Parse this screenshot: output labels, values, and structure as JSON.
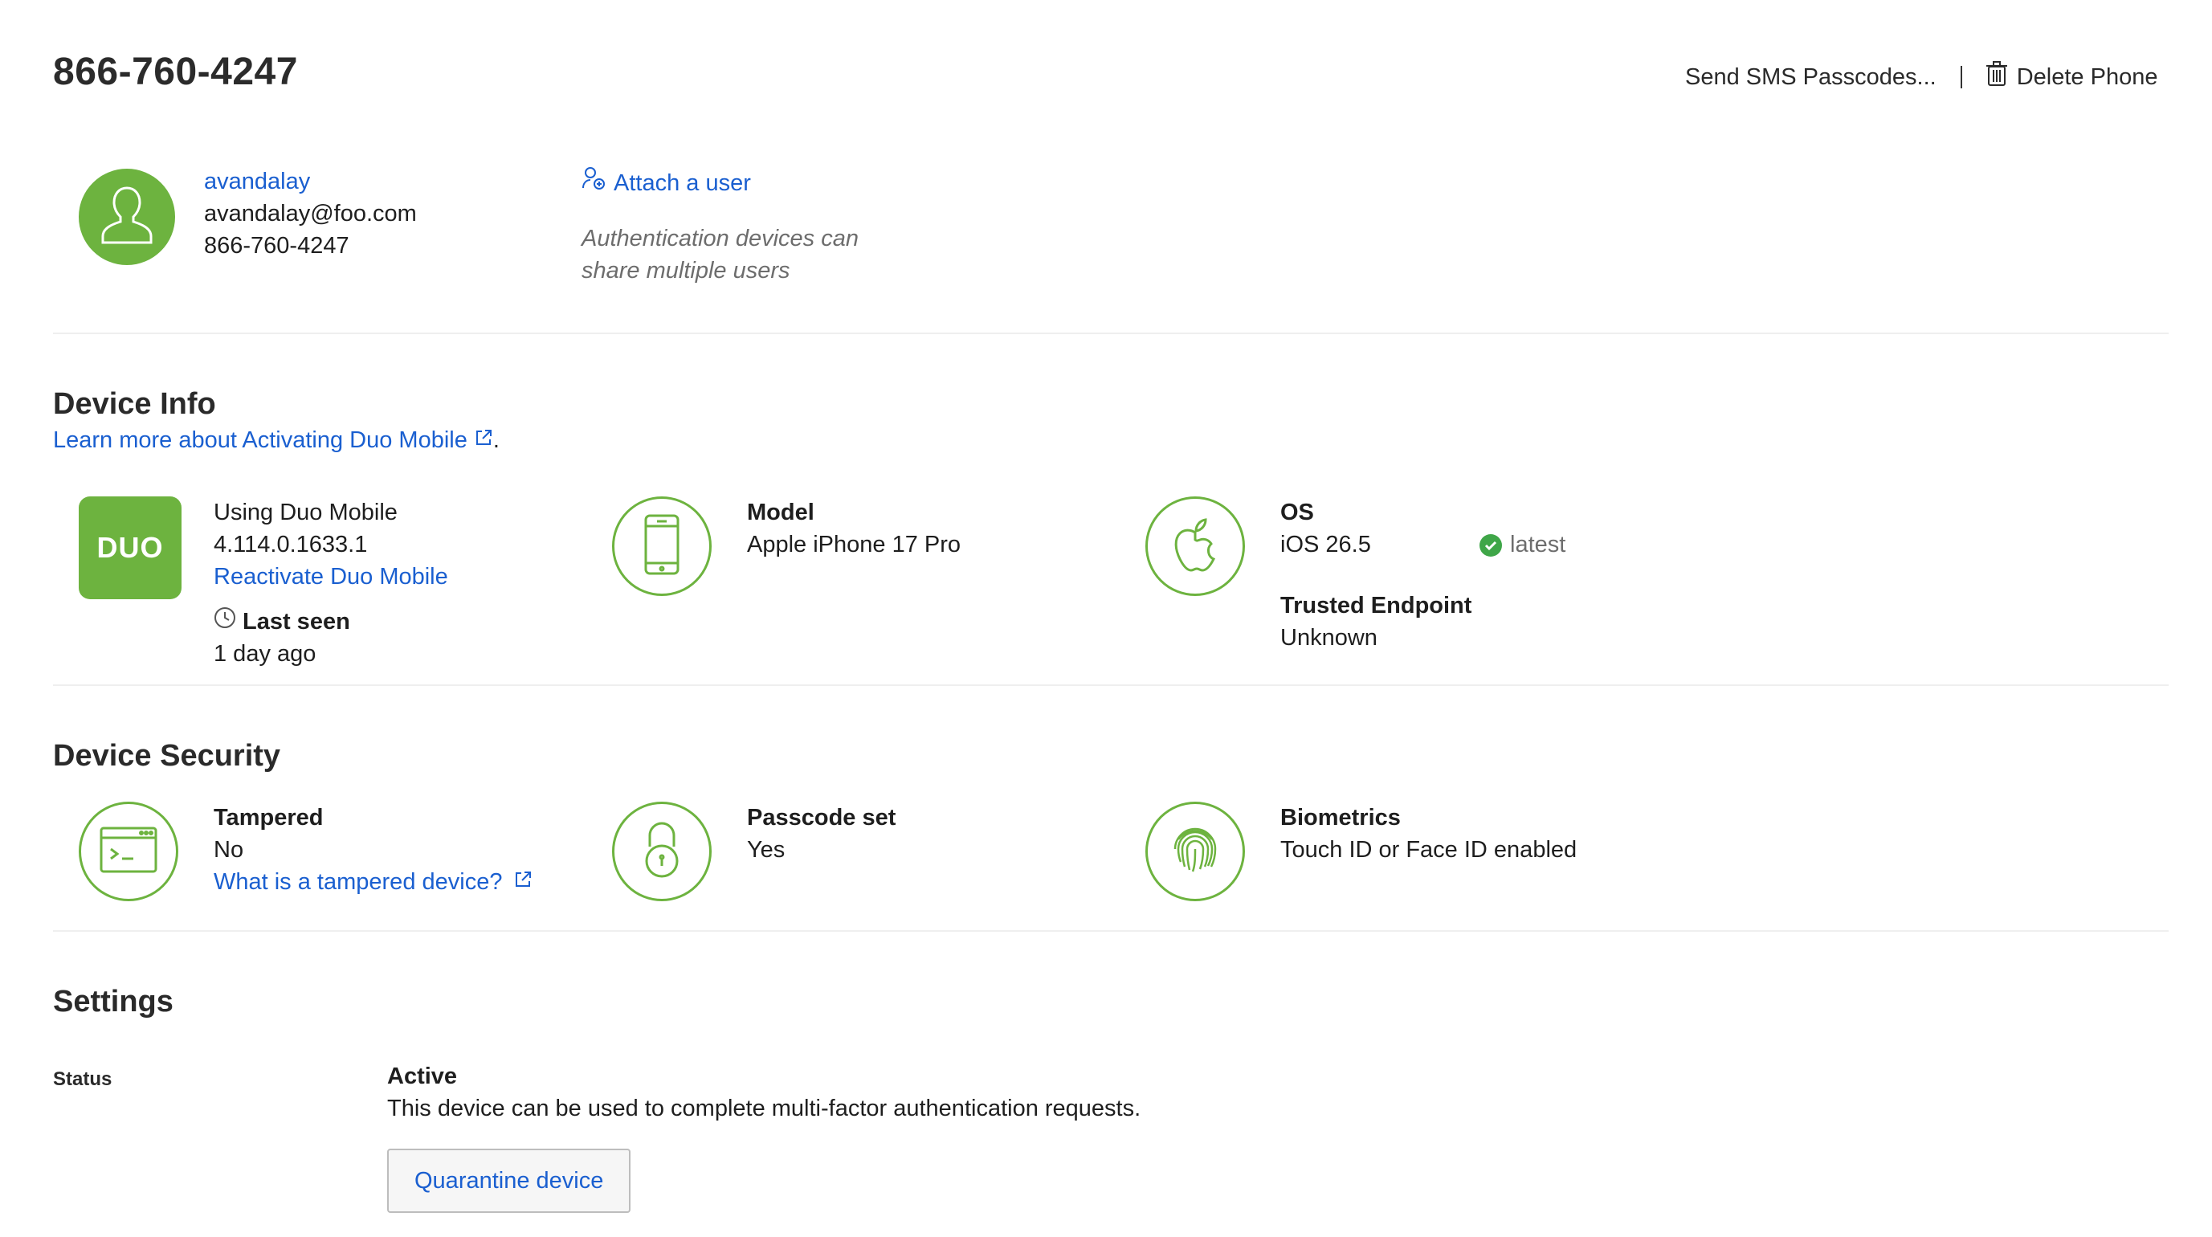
{
  "header": {
    "title": "866-760-4247",
    "send_sms": "Send SMS Passcodes...",
    "delete_phone": "Delete Phone"
  },
  "user": {
    "username": "avandalay",
    "email": "avandalay@foo.com",
    "phone": "866-760-4247",
    "attach_label": "Attach a user",
    "attach_note_line1": "Authentication devices can",
    "attach_note_line2": "share multiple users"
  },
  "device_info": {
    "heading": "Device Info",
    "learn_more": "Learn more about Activating Duo Mobile",
    "period": ".",
    "app": {
      "logo_text": "DUO",
      "using": "Using Duo Mobile",
      "version": "4.114.0.1633.1",
      "reactivate": "Reactivate Duo Mobile",
      "last_seen_label": "Last seen",
      "last_seen_value": "1 day ago"
    },
    "model": {
      "label": "Model",
      "value": "Apple iPhone 17 Pro"
    },
    "os": {
      "label": "OS",
      "value": "iOS 26.5",
      "badge": "latest",
      "trusted_label": "Trusted Endpoint",
      "trusted_value": "Unknown"
    }
  },
  "device_security": {
    "heading": "Device Security",
    "tampered": {
      "label": "Tampered",
      "value": "No",
      "link": "What is a tampered device?"
    },
    "passcode": {
      "label": "Passcode set",
      "value": "Yes"
    },
    "biometrics": {
      "label": "Biometrics",
      "value": "Touch ID or Face ID enabled"
    }
  },
  "settings": {
    "heading": "Settings",
    "status_label": "Status",
    "status_value": "Active",
    "status_desc": "This device can be used to complete multi-factor authentication requests.",
    "quarantine_button": "Quarantine device"
  },
  "colors": {
    "accent_green": "#6db33f",
    "link_blue": "#1a5fd0",
    "check_green": "#3fa648"
  }
}
